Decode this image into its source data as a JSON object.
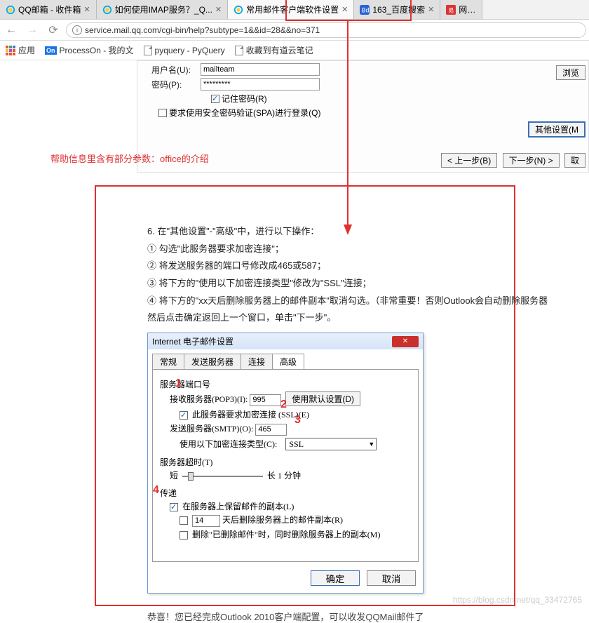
{
  "tabs": [
    {
      "label": "QQ邮箱 - 收件箱",
      "icon": "qq"
    },
    {
      "label": "如何使用IMAP服务？_Q...",
      "icon": "qq"
    },
    {
      "label": "常用邮件客户端软件设置",
      "icon": "qq",
      "active": true
    },
    {
      "label": "163_百度搜索",
      "icon": "baidu"
    },
    {
      "label": "网易邮",
      "icon": "163"
    }
  ],
  "nav": {
    "back": "←",
    "forward": "→",
    "reload": "⟳"
  },
  "url": "service.mail.qq.com/cgi-bin/help?subtype=1&&id=28&&no=371",
  "bookmarks": {
    "apps": "应用",
    "processon": "ProcessOn - 我的文",
    "pyquery": "pyquery - PyQuery",
    "youdao": "收藏到有道云笔记"
  },
  "bg_form": {
    "username_label": "用户名(U):",
    "username_value": "mailteam",
    "password_label": "密码(P):",
    "password_value": "*********",
    "remember": "记住密码(R)",
    "spa": "要求使用安全密码验证(SPA)进行登录(Q)",
    "other_settings": "其他设置(M",
    "browse": "浏览",
    "prev": "< 上一步(B)",
    "next": "下一步(N) >",
    "cancel": "取"
  },
  "annotation": "帮助信息里含有部分参数：office的介绍",
  "help": {
    "l1": "6. 在\"其他设置\"-\"高级\"中，进行以下操作：",
    "l2": "① 勾选\"此服务器要求加密连接\"；",
    "l3": "② 将发送服务器的端口号修改成465或587；",
    "l4": "③ 将下方的\"使用以下加密连接类型\"修改为\"SSL\"连接；",
    "l5": "④ 将下方的\"xx天后删除服务器上的邮件副本\"取消勾选。（非常重要！否则Outlook会自动删除服务器",
    "l6": "然后点击确定返回上一个窗口，单击\"下一步\"。"
  },
  "dialog": {
    "title": "Internet 电子邮件设置",
    "tabs": [
      "常规",
      "发送服务器",
      "连接",
      "高级"
    ],
    "active_tab": 3,
    "section_port": "服务器端口号",
    "pop3_label": "接收服务器(POP3)(I):",
    "pop3_value": "995",
    "use_default": "使用默认设置(D)",
    "ssl_required": "此服务器要求加密连接 (SSL)(E)",
    "smtp_label": "发送服务器(SMTP)(O):",
    "smtp_value": "465",
    "enc_label": "使用以下加密连接类型(C):",
    "enc_value": "SSL",
    "section_timeout": "服务器超时(T)",
    "timeout_short": "短",
    "timeout_long": "长  1 分钟",
    "section_delivery": "传递",
    "keep_copy": "在服务器上保留邮件的副本(L)",
    "days_value": "14",
    "delete_after": "天后删除服务器上的邮件副本(R)",
    "delete_deleted": "删除\"已删除邮件\"时，同时删除服务器上的副本(M)",
    "ok": "确定",
    "cancel": "取消"
  },
  "annotations_num": {
    "n1": "1",
    "n2": "2",
    "n3": "3",
    "n4": "4"
  },
  "footer": "恭喜！您已经完成Outlook 2010客户端配置，可以收发QQMail邮件了",
  "watermark": "https://blog.csdn.net/qq_33472765"
}
